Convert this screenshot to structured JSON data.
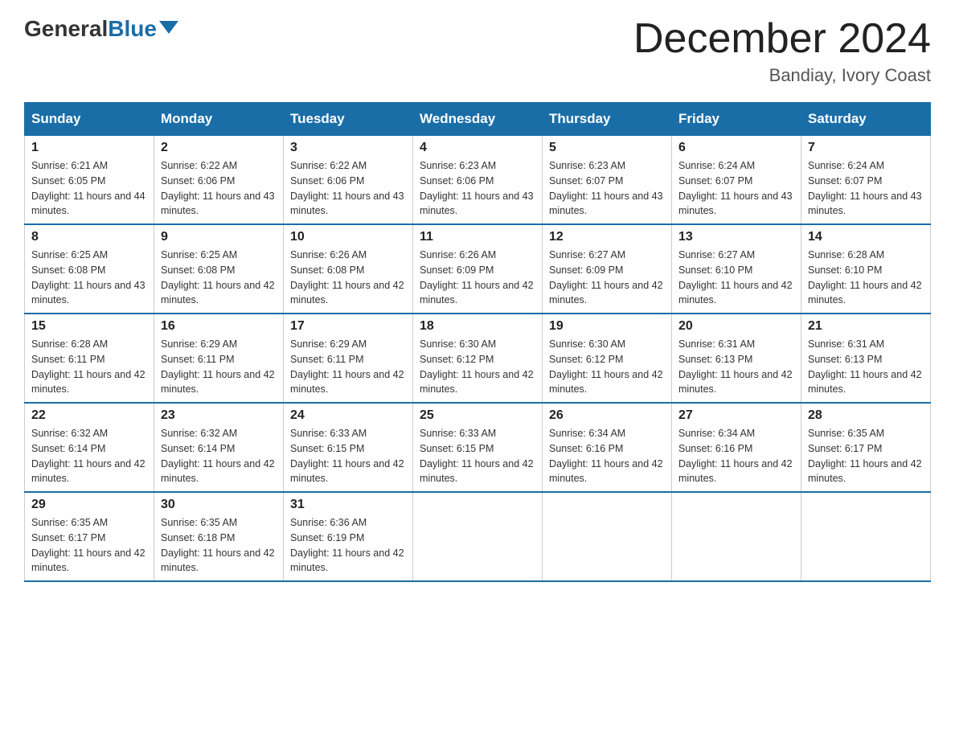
{
  "header": {
    "logo_general": "General",
    "logo_blue": "Blue",
    "month_title": "December 2024",
    "location": "Bandiay, Ivory Coast"
  },
  "columns": [
    "Sunday",
    "Monday",
    "Tuesday",
    "Wednesday",
    "Thursday",
    "Friday",
    "Saturday"
  ],
  "weeks": [
    [
      {
        "day": "1",
        "sunrise": "6:21 AM",
        "sunset": "6:05 PM",
        "daylight": "11 hours and 44 minutes."
      },
      {
        "day": "2",
        "sunrise": "6:22 AM",
        "sunset": "6:06 PM",
        "daylight": "11 hours and 43 minutes."
      },
      {
        "day": "3",
        "sunrise": "6:22 AM",
        "sunset": "6:06 PM",
        "daylight": "11 hours and 43 minutes."
      },
      {
        "day": "4",
        "sunrise": "6:23 AM",
        "sunset": "6:06 PM",
        "daylight": "11 hours and 43 minutes."
      },
      {
        "day": "5",
        "sunrise": "6:23 AM",
        "sunset": "6:07 PM",
        "daylight": "11 hours and 43 minutes."
      },
      {
        "day": "6",
        "sunrise": "6:24 AM",
        "sunset": "6:07 PM",
        "daylight": "11 hours and 43 minutes."
      },
      {
        "day": "7",
        "sunrise": "6:24 AM",
        "sunset": "6:07 PM",
        "daylight": "11 hours and 43 minutes."
      }
    ],
    [
      {
        "day": "8",
        "sunrise": "6:25 AM",
        "sunset": "6:08 PM",
        "daylight": "11 hours and 43 minutes."
      },
      {
        "day": "9",
        "sunrise": "6:25 AM",
        "sunset": "6:08 PM",
        "daylight": "11 hours and 42 minutes."
      },
      {
        "day": "10",
        "sunrise": "6:26 AM",
        "sunset": "6:08 PM",
        "daylight": "11 hours and 42 minutes."
      },
      {
        "day": "11",
        "sunrise": "6:26 AM",
        "sunset": "6:09 PM",
        "daylight": "11 hours and 42 minutes."
      },
      {
        "day": "12",
        "sunrise": "6:27 AM",
        "sunset": "6:09 PM",
        "daylight": "11 hours and 42 minutes."
      },
      {
        "day": "13",
        "sunrise": "6:27 AM",
        "sunset": "6:10 PM",
        "daylight": "11 hours and 42 minutes."
      },
      {
        "day": "14",
        "sunrise": "6:28 AM",
        "sunset": "6:10 PM",
        "daylight": "11 hours and 42 minutes."
      }
    ],
    [
      {
        "day": "15",
        "sunrise": "6:28 AM",
        "sunset": "6:11 PM",
        "daylight": "11 hours and 42 minutes."
      },
      {
        "day": "16",
        "sunrise": "6:29 AM",
        "sunset": "6:11 PM",
        "daylight": "11 hours and 42 minutes."
      },
      {
        "day": "17",
        "sunrise": "6:29 AM",
        "sunset": "6:11 PM",
        "daylight": "11 hours and 42 minutes."
      },
      {
        "day": "18",
        "sunrise": "6:30 AM",
        "sunset": "6:12 PM",
        "daylight": "11 hours and 42 minutes."
      },
      {
        "day": "19",
        "sunrise": "6:30 AM",
        "sunset": "6:12 PM",
        "daylight": "11 hours and 42 minutes."
      },
      {
        "day": "20",
        "sunrise": "6:31 AM",
        "sunset": "6:13 PM",
        "daylight": "11 hours and 42 minutes."
      },
      {
        "day": "21",
        "sunrise": "6:31 AM",
        "sunset": "6:13 PM",
        "daylight": "11 hours and 42 minutes."
      }
    ],
    [
      {
        "day": "22",
        "sunrise": "6:32 AM",
        "sunset": "6:14 PM",
        "daylight": "11 hours and 42 minutes."
      },
      {
        "day": "23",
        "sunrise": "6:32 AM",
        "sunset": "6:14 PM",
        "daylight": "11 hours and 42 minutes."
      },
      {
        "day": "24",
        "sunrise": "6:33 AM",
        "sunset": "6:15 PM",
        "daylight": "11 hours and 42 minutes."
      },
      {
        "day": "25",
        "sunrise": "6:33 AM",
        "sunset": "6:15 PM",
        "daylight": "11 hours and 42 minutes."
      },
      {
        "day": "26",
        "sunrise": "6:34 AM",
        "sunset": "6:16 PM",
        "daylight": "11 hours and 42 minutes."
      },
      {
        "day": "27",
        "sunrise": "6:34 AM",
        "sunset": "6:16 PM",
        "daylight": "11 hours and 42 minutes."
      },
      {
        "day": "28",
        "sunrise": "6:35 AM",
        "sunset": "6:17 PM",
        "daylight": "11 hours and 42 minutes."
      }
    ],
    [
      {
        "day": "29",
        "sunrise": "6:35 AM",
        "sunset": "6:17 PM",
        "daylight": "11 hours and 42 minutes."
      },
      {
        "day": "30",
        "sunrise": "6:35 AM",
        "sunset": "6:18 PM",
        "daylight": "11 hours and 42 minutes."
      },
      {
        "day": "31",
        "sunrise": "6:36 AM",
        "sunset": "6:19 PM",
        "daylight": "11 hours and 42 minutes."
      },
      null,
      null,
      null,
      null
    ]
  ]
}
